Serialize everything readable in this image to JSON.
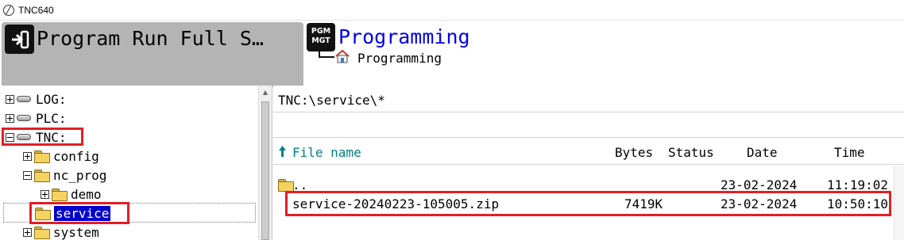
{
  "window": {
    "title": "TNC640"
  },
  "modes": {
    "machine_label": "Program Run Full S…",
    "machine_icon": "program-run-icon",
    "programming_label": "Programming",
    "programming_icon_line1": "PGM",
    "programming_icon_line2": "MGT",
    "sub_label": "Programming"
  },
  "tree": [
    {
      "label": "LOG:",
      "icon": "drive-icon",
      "expander": "plus"
    },
    {
      "label": "PLC:",
      "icon": "drive-icon",
      "expander": "plus"
    },
    {
      "label": "TNC:",
      "icon": "drive-icon",
      "expander": "minus"
    },
    {
      "label": "config",
      "icon": "folder-icon",
      "expander": "plus"
    },
    {
      "label": "nc_prog",
      "icon": "folder-icon",
      "expander": "minus"
    },
    {
      "label": "demo",
      "icon": "folder-icon",
      "expander": "plus"
    },
    {
      "label": "service",
      "icon": "folder-icon",
      "expander": "none",
      "selected": true
    },
    {
      "label": "system",
      "icon": "folder-icon",
      "expander": "plus"
    }
  ],
  "file_panel": {
    "path": "TNC:\\service\\*",
    "columns": {
      "name": "File name",
      "bytes": "Bytes",
      "status": "Status",
      "date": "Date",
      "time": "Time"
    },
    "files": [
      {
        "name": "..",
        "bytes": "",
        "status": "",
        "date": "23-02-2024",
        "time": "11:19:02",
        "icon": "folder-icon"
      },
      {
        "name": "service-20240223-105005.zip",
        "bytes": "7419K",
        "status": "",
        "date": "23-02-2024",
        "time": "10:50:10",
        "icon": ""
      }
    ]
  },
  "colors": {
    "highlight": "#e31e24",
    "selection": "#0000cc",
    "mode_tab": "#b4b4b4",
    "programming_text": "#0000ee",
    "column_sort": "#008080"
  }
}
